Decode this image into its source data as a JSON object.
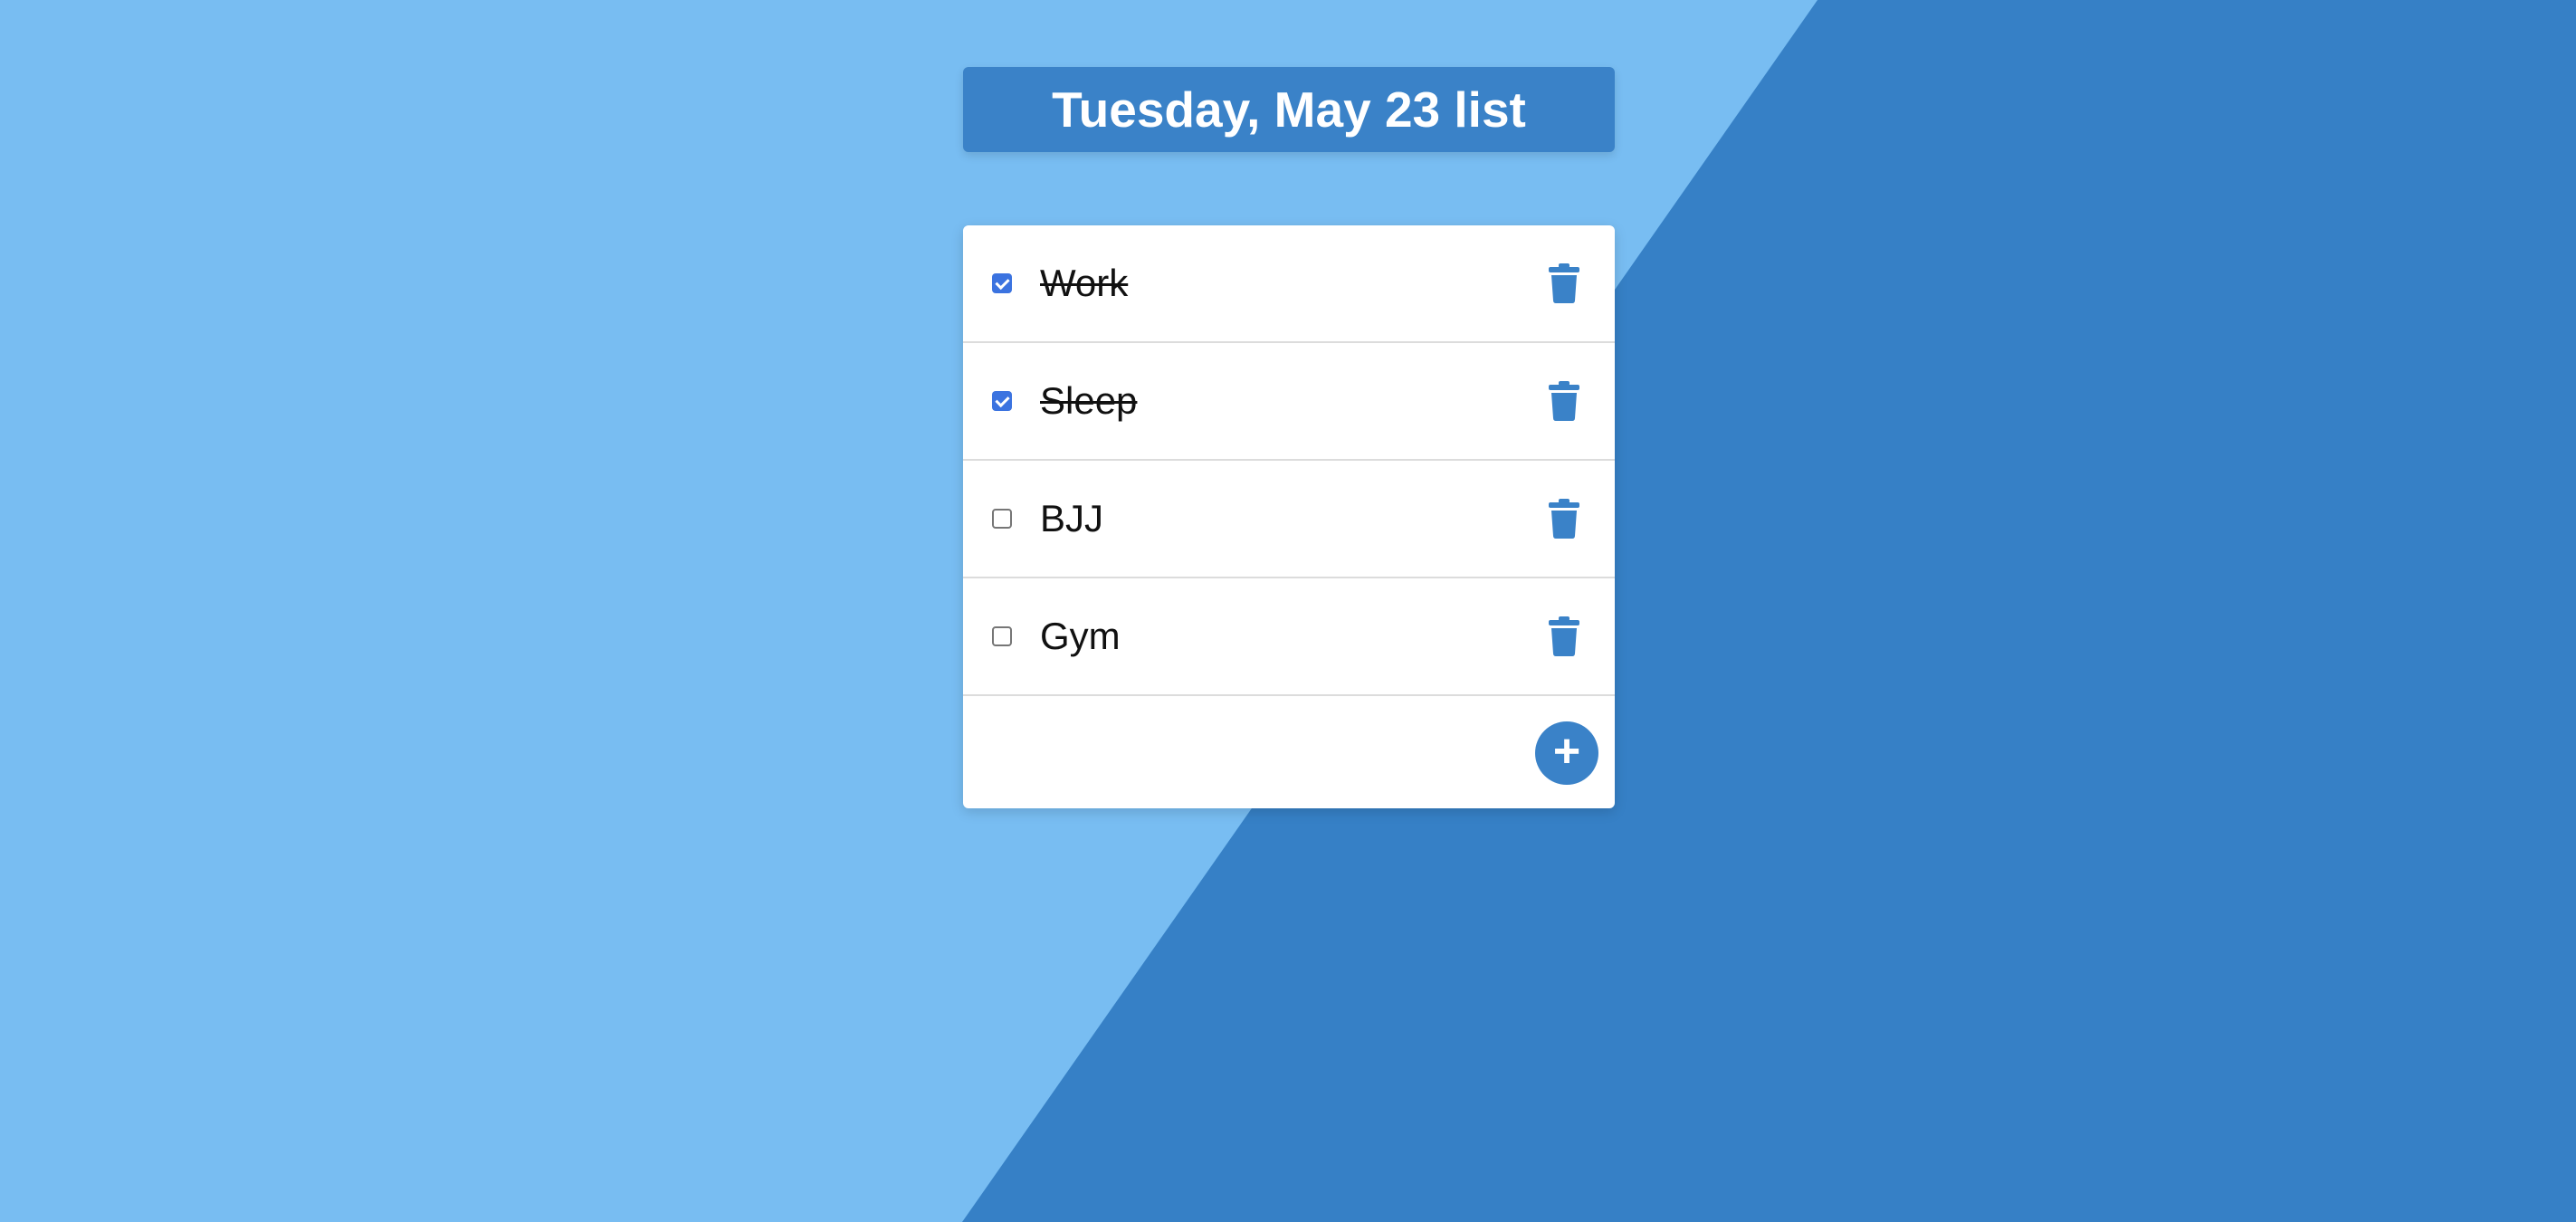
{
  "header": {
    "title": "Tuesday, May 23 list"
  },
  "colors": {
    "background_light": "#78bdf2",
    "background_dark": "#3680c6",
    "accent": "#3a82c8",
    "checkbox_checked": "#3b73e0"
  },
  "list": {
    "items": [
      {
        "label": "Work",
        "checked": true,
        "delete_icon": "trash-icon"
      },
      {
        "label": "Sleep",
        "checked": true,
        "delete_icon": "trash-icon"
      },
      {
        "label": "BJJ",
        "checked": false,
        "delete_icon": "trash-icon"
      },
      {
        "label": "Gym",
        "checked": false,
        "delete_icon": "trash-icon"
      }
    ],
    "add_button_symbol": "+"
  }
}
